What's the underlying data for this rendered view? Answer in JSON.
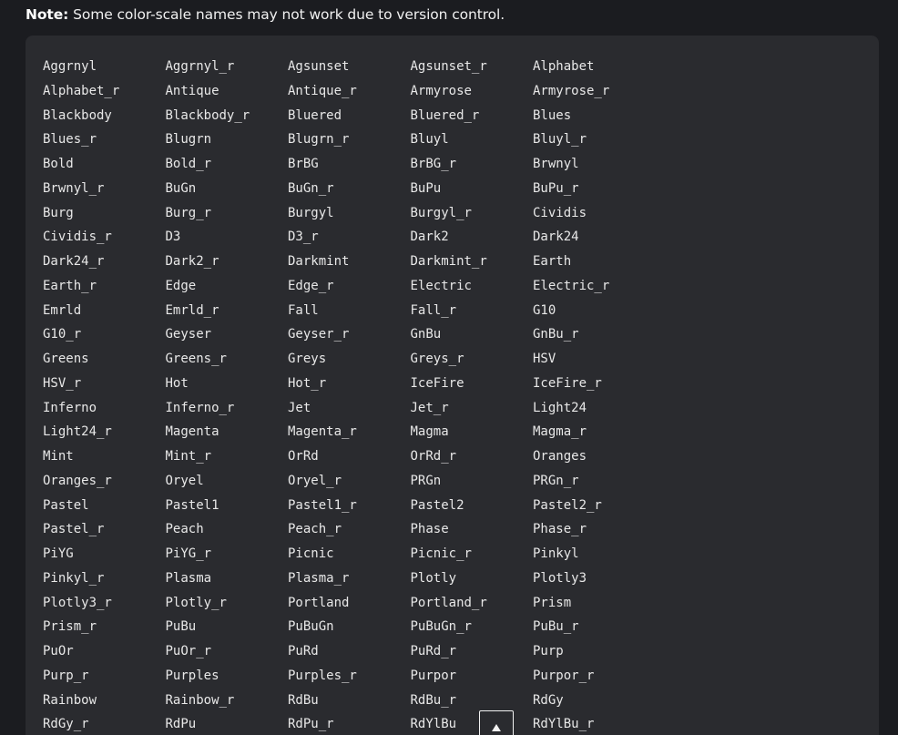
{
  "note": {
    "label": "Note:",
    "text": " Some color-scale names may not work due to version control."
  },
  "scroll_top_icon": "arrow-up-icon",
  "colorscales": [
    "Aggrnyl",
    "Aggrnyl_r",
    "Agsunset",
    "Agsunset_r",
    "Alphabet",
    "Alphabet_r",
    "Antique",
    "Antique_r",
    "Armyrose",
    "Armyrose_r",
    "Blackbody",
    "Blackbody_r",
    "Bluered",
    "Bluered_r",
    "Blues",
    "Blues_r",
    "Blugrn",
    "Blugrn_r",
    "Bluyl",
    "Bluyl_r",
    "Bold",
    "Bold_r",
    "BrBG",
    "BrBG_r",
    "Brwnyl",
    "Brwnyl_r",
    "BuGn",
    "BuGn_r",
    "BuPu",
    "BuPu_r",
    "Burg",
    "Burg_r",
    "Burgyl",
    "Burgyl_r",
    "Cividis",
    "Cividis_r",
    "D3",
    "D3_r",
    "Dark2",
    "Dark24",
    "Dark24_r",
    "Dark2_r",
    "Darkmint",
    "Darkmint_r",
    "Earth",
    "Earth_r",
    "Edge",
    "Edge_r",
    "Electric",
    "Electric_r",
    "Emrld",
    "Emrld_r",
    "Fall",
    "Fall_r",
    "G10",
    "G10_r",
    "Geyser",
    "Geyser_r",
    "GnBu",
    "GnBu_r",
    "Greens",
    "Greens_r",
    "Greys",
    "Greys_r",
    "HSV",
    "HSV_r",
    "Hot",
    "Hot_r",
    "IceFire",
    "IceFire_r",
    "Inferno",
    "Inferno_r",
    "Jet",
    "Jet_r",
    "Light24",
    "Light24_r",
    "Magenta",
    "Magenta_r",
    "Magma",
    "Magma_r",
    "Mint",
    "Mint_r",
    "OrRd",
    "OrRd_r",
    "Oranges",
    "Oranges_r",
    "Oryel",
    "Oryel_r",
    "PRGn",
    "PRGn_r",
    "Pastel",
    "Pastel1",
    "Pastel1_r",
    "Pastel2",
    "Pastel2_r",
    "Pastel_r",
    "Peach",
    "Peach_r",
    "Phase",
    "Phase_r",
    "PiYG",
    "PiYG_r",
    "Picnic",
    "Picnic_r",
    "Pinkyl",
    "Pinkyl_r",
    "Plasma",
    "Plasma_r",
    "Plotly",
    "Plotly3",
    "Plotly3_r",
    "Plotly_r",
    "Portland",
    "Portland_r",
    "Prism",
    "Prism_r",
    "PuBu",
    "PuBuGn",
    "PuBuGn_r",
    "PuBu_r",
    "PuOr",
    "PuOr_r",
    "PuRd",
    "PuRd_r",
    "Purp",
    "Purp_r",
    "Purples",
    "Purples_r",
    "Purpor",
    "Purpor_r",
    "Rainbow",
    "Rainbow_r",
    "RdBu",
    "RdBu_r",
    "RdGy",
    "RdGy_r",
    "RdPu",
    "RdPu_r",
    "RdYlBu",
    "RdYlBu_r"
  ]
}
